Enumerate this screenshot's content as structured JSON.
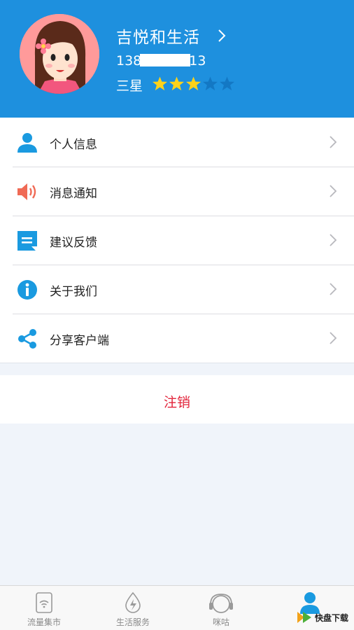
{
  "profile": {
    "name": "吉悦和生活",
    "phone_prefix": "138",
    "phone_suffix": "13",
    "level_label": "三星",
    "stars_filled": 3,
    "stars_total": 5
  },
  "menu": {
    "items": [
      {
        "label": "个人信息",
        "icon": "person-icon"
      },
      {
        "label": "消息通知",
        "icon": "speaker-icon"
      },
      {
        "label": "建议反馈",
        "icon": "feedback-icon"
      },
      {
        "label": "关于我们",
        "icon": "info-icon"
      },
      {
        "label": "分享客户端",
        "icon": "share-icon"
      }
    ]
  },
  "logout": {
    "label": "注销"
  },
  "tabbar": {
    "tabs": [
      {
        "label": "流量集市",
        "icon": "wifi-card-icon"
      },
      {
        "label": "生活服务",
        "icon": "energy-drop-icon"
      },
      {
        "label": "咪咕",
        "icon": "headphones-icon"
      },
      {
        "label": "",
        "icon": "user-icon",
        "active": true
      }
    ]
  },
  "watermark": {
    "title": "快盘下载"
  },
  "colors": {
    "header": "#1e90de",
    "accent_blue": "#1a9ae0",
    "star_filled": "#ffd21a",
    "star_empty": "#1378c4",
    "logout_red": "#e2233a",
    "speaker_red": "#f06a55"
  }
}
